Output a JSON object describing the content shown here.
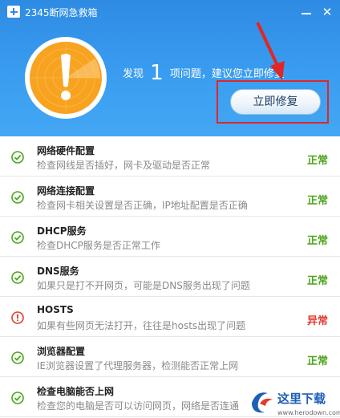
{
  "window": {
    "title": "2345断网急救箱"
  },
  "summary": {
    "prefix": "发现",
    "count": "1",
    "suffix": "项问题，建议您立即修复",
    "fix_button": "立即修复"
  },
  "items": [
    {
      "title": "网络硬件配置",
      "desc": "检查网线是否插好，网卡及驱动是否正常",
      "status": "正常",
      "state": "ok"
    },
    {
      "title": "网络连接配置",
      "desc": "检查网卡相关设置是否正确，IP地址配置是否正确",
      "status": "正常",
      "state": "ok"
    },
    {
      "title": "DHCP服务",
      "desc": "检查DHCP服务是否正常工作",
      "status": "正常",
      "state": "ok"
    },
    {
      "title": "DNS服务",
      "desc": "如果只是打不开网页，可能是DNS服务出现了问题",
      "status": "正常",
      "state": "ok"
    },
    {
      "title": "HOSTS",
      "desc": "如果有些网页无法打开，往往是hosts出现了问题",
      "status": "异常",
      "state": "error"
    },
    {
      "title": "浏览器配置",
      "desc": "IE浏览器设置了代理服务器，检测能否正常上网",
      "status": "正常",
      "state": "ok"
    },
    {
      "title": "检查电脑能否上网",
      "desc": "检查您的电脑是否可以访问网页，网络是否连通",
      "status": "",
      "state": "ok"
    }
  ],
  "watermark": {
    "text": "这里下载",
    "url": "www.herodown.com"
  },
  "colors": {
    "header": "#3a9df0",
    "ok": "#4aa51a",
    "error": "#e43b2e",
    "badge": "#f7a320"
  }
}
